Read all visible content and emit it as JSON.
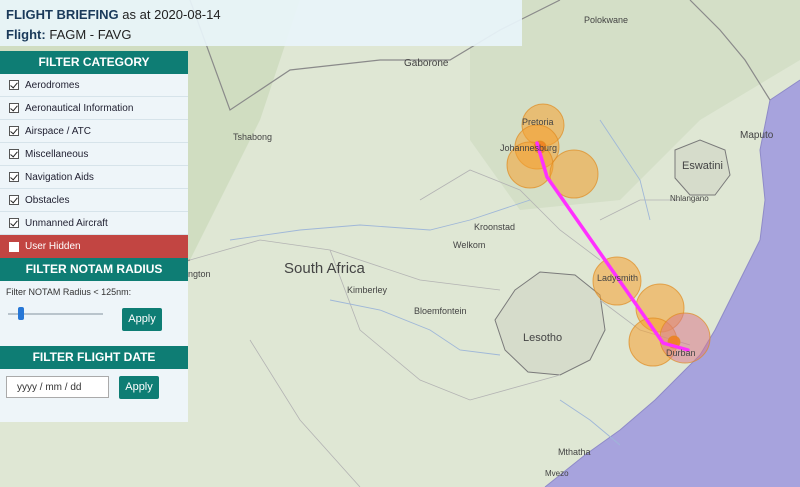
{
  "header": {
    "briefing_label": "FLIGHT BRIEFING",
    "as_at": "as at 2020-08-14",
    "flight_label": "Flight:",
    "flight_route": "FAGM - FAVG"
  },
  "filter_category": {
    "title": "FILTER CATEGORY",
    "items": [
      {
        "label": "Aerodromes",
        "checked": true
      },
      {
        "label": "Aeronautical Information",
        "checked": true
      },
      {
        "label": "Airspace / ATC",
        "checked": true
      },
      {
        "label": "Miscellaneous",
        "checked": true
      },
      {
        "label": "Navigation Aids",
        "checked": true
      },
      {
        "label": "Obstacles",
        "checked": true
      },
      {
        "label": "Unmanned Aircraft",
        "checked": true
      },
      {
        "label": "User Hidden",
        "checked": false
      }
    ]
  },
  "filter_radius": {
    "title": "FILTER NOTAM RADIUS",
    "label": "Filter NOTAM Radius < 125nm:",
    "apply_label": "Apply",
    "slider_fraction": 0.1
  },
  "filter_date": {
    "title": "FILTER FLIGHT DATE",
    "placeholder": "yyyy / mm / dd",
    "apply_label": "Apply"
  },
  "map": {
    "labels": {
      "gaborone": "Gaborone",
      "polokwane": "Polokwane",
      "tshabong": "Tshabong",
      "pretoria": "Pretoria",
      "johannesburg": "Johannesburg",
      "maputo": "Maputo",
      "eswatini": "Eswatini",
      "nhlangano": "Nhlangano",
      "kroonstad": "Kroonstad",
      "welkom": "Welkom",
      "south_africa": "South Africa",
      "kimberley": "Kimberley",
      "upington": "ngton",
      "bloemfontein": "Bloemfontein",
      "ladysmith": "Ladysmith",
      "lesotho": "Lesotho",
      "durban": "Durban",
      "mthatha": "Mthatha",
      "mvezo": "Mvezo"
    },
    "colors": {
      "route": "#ff30ff",
      "notam_fill": "#f5a030",
      "land": "#dfe7d4",
      "sea": "#a7a3dd"
    }
  }
}
